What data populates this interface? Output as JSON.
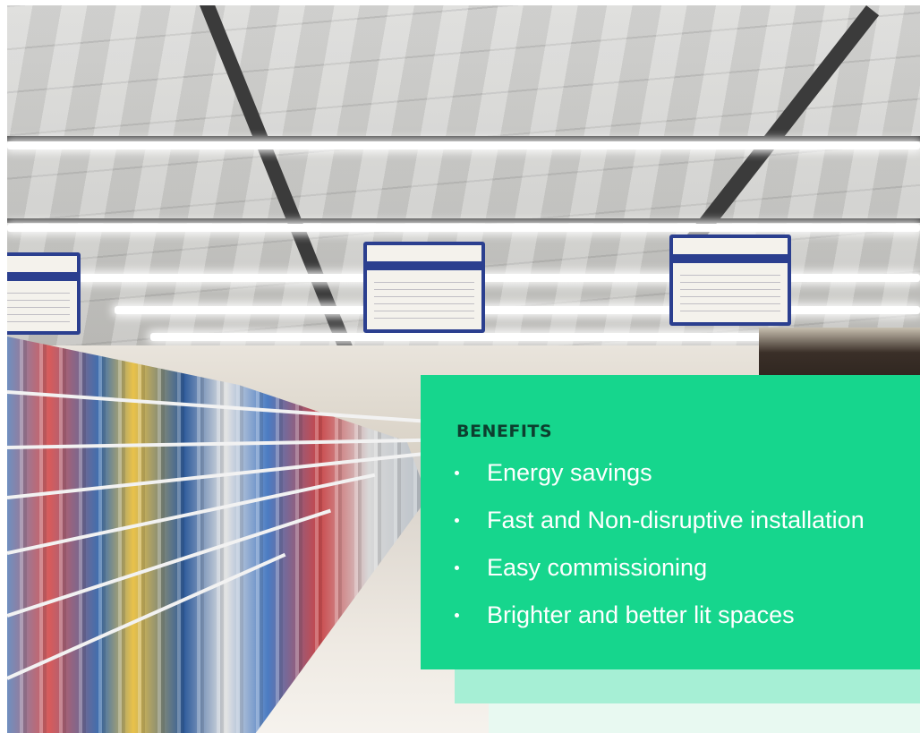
{
  "photo": {
    "icon": "supermarket-aisle-photo"
  },
  "benefits": {
    "title": "BENEFITS",
    "items": [
      {
        "label": "Energy savings"
      },
      {
        "label": "Fast and Non-disruptive installation"
      },
      {
        "label": "Easy commissioning"
      },
      {
        "label": "Brighter and better lit spaces"
      }
    ]
  },
  "colors": {
    "panel_main": "#16d68d",
    "panel_light": "#a6efd5",
    "panel_lightest": "#e8f9f1",
    "title_text": "#0d3f2f",
    "item_text": "#ffffff"
  }
}
